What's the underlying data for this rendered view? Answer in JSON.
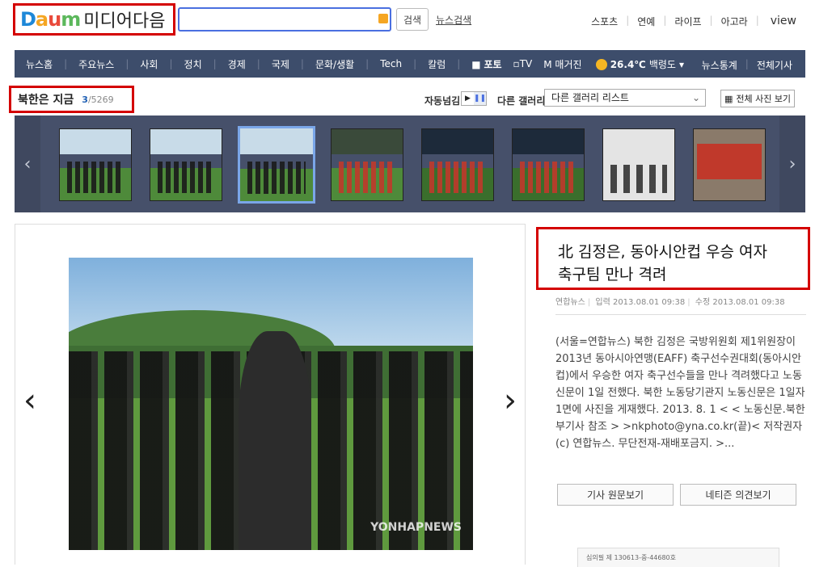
{
  "logo": {
    "brand_d": "D",
    "brand_a": "a",
    "brand_u": "u",
    "brand_m": "m",
    "text": "미디어다음"
  },
  "search": {
    "button_label": "검색",
    "news_search_label": "뉴스검색"
  },
  "top_nav": {
    "items": [
      "스포츠",
      "연예",
      "라이프",
      "아고라"
    ],
    "view": "view"
  },
  "gnb": {
    "items": [
      "뉴스홈",
      "주요뉴스",
      "사회",
      "정치",
      "경제",
      "국제",
      "문화/생활",
      "Tech",
      "칼럼"
    ],
    "photo": "포토",
    "tv": "TV",
    "magazine": "매거진",
    "weather": {
      "temp": "26.4℃",
      "city": "백령도"
    },
    "stats": "뉴스통계",
    "all": "전체기사"
  },
  "gallery": {
    "title": "북한은 지금",
    "current": "3",
    "total": "/5269",
    "auto_label": "자동넘김",
    "other_label": "다른 갤러리",
    "select_value": "다른 갤러리 리스트",
    "all_photos": "전체 사진 보기"
  },
  "article": {
    "headline_line1": "北 김정은, 동아시안컵 우승 여자",
    "headline_line2": "축구팀 만나 격려",
    "source": "연합뉴스",
    "input_time": "입력 2013.08.01 09:38",
    "edit_time": "수정 2013.08.01 09:38",
    "body": "(서울=연합뉴스) 북한 김정은 국방위원회 제1위원장이 2013년 동아시아연맹(EAFF) 축구선수권대회(동아시안컵)에서 우승한 여자 축구선수들을 만나 격려했다고 노동신문이 1일 전했다. 북한 노동당기관지 노동신문은 1일자 1면에 사진을 게재했다. 2013. 8. 1 < < 노동신문.북한부기사 참조 > >nkphoto@yna.co.kr(끝)< 저작권자(c) 연합뉴스. 무단전재-재배포금지. >...",
    "btn_original": "기사 원문보기",
    "btn_comments": "네티즌 의견보기",
    "watermark": "YONHAPNEWS"
  },
  "ad": {
    "text": "심의필 제 130613-중-44680호"
  }
}
